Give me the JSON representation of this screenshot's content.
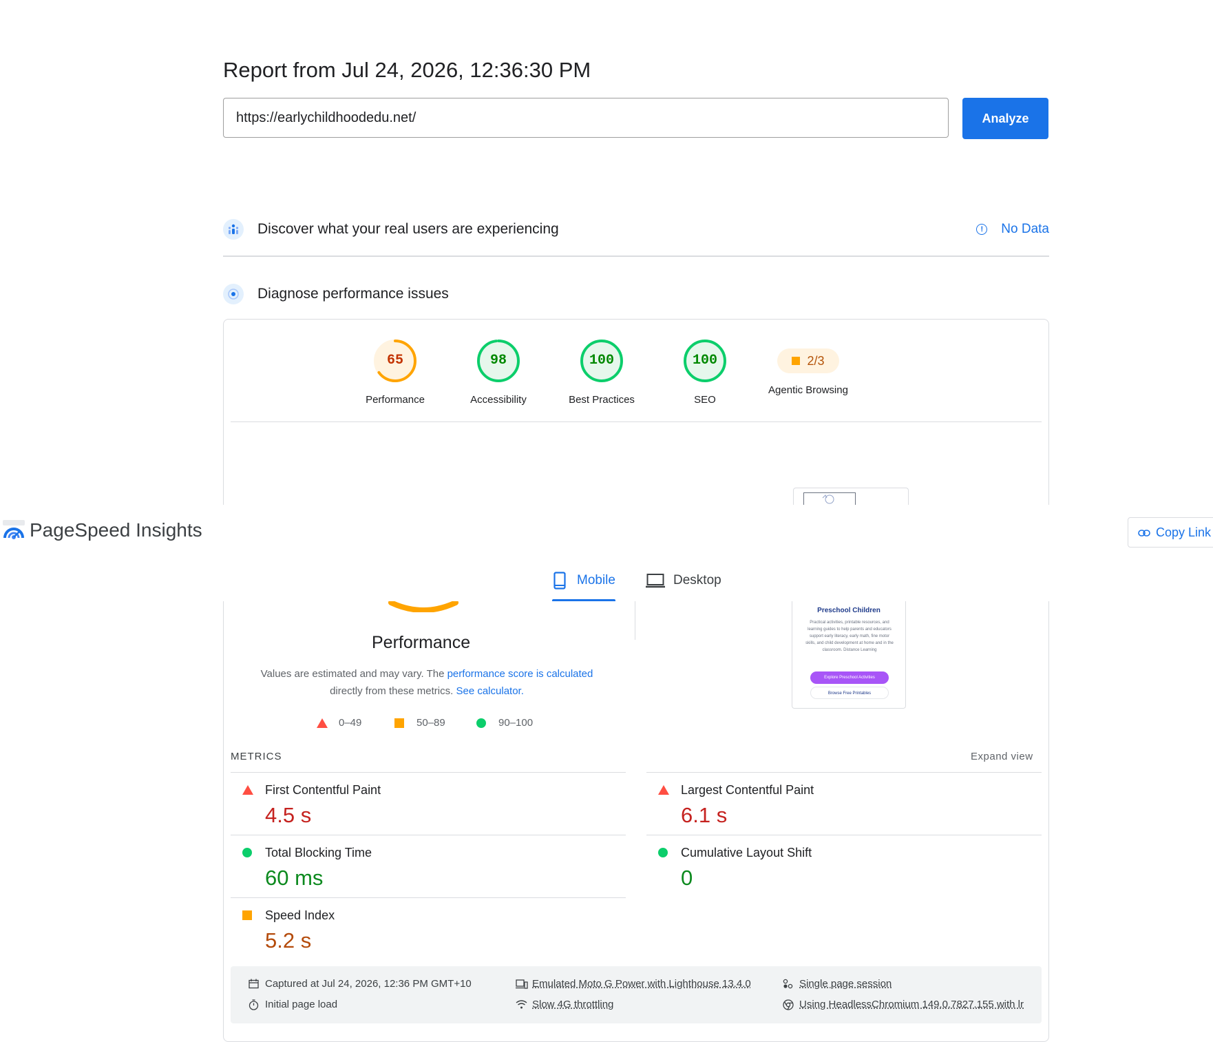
{
  "report": {
    "title": "Report from Jul 24, 2026, 12:36:30 PM",
    "url_value": "https://earlychildhoodedu.net/",
    "analyze_label": "Analyze"
  },
  "field_data": {
    "title": "Discover what your real users are experiencing",
    "status": "No Data"
  },
  "diagnose": {
    "title": "Diagnose performance issues"
  },
  "scores": [
    {
      "value": "65",
      "label": "Performance",
      "score": 65,
      "color": "#ffa400",
      "fill": "#fff3e0",
      "text": "#c33300"
    },
    {
      "value": "98",
      "label": "Accessibility",
      "score": 98,
      "color": "#0cce6b",
      "fill": "#e6f7ec",
      "text": "#008800"
    },
    {
      "value": "100",
      "label": "Best Practices",
      "score": 100,
      "color": "#0cce6b",
      "fill": "#e6f7ec",
      "text": "#008800"
    },
    {
      "value": "100",
      "label": "SEO",
      "score": 100,
      "color": "#0cce6b",
      "fill": "#e6f7ec",
      "text": "#008800"
    }
  ],
  "agentic": {
    "value": "2/3",
    "label": "Agentic Browsing"
  },
  "header": {
    "title": "PageSpeed Insights",
    "copy_link": "Copy Link"
  },
  "tabs": {
    "mobile": "Mobile",
    "desktop": "Desktop",
    "active": "mobile"
  },
  "performance": {
    "title": "Performance",
    "note_prefix": "Values are estimated and may vary. The ",
    "note_link1": "performance score is calculated",
    "note_middle": "directly from these metrics.",
    "note_link2": "See calculator.",
    "legend": [
      "0–49",
      "50–89",
      "90–100"
    ]
  },
  "screenshot": {
    "heading": "Preschool Children",
    "text": "Practical activities, printable resources, and learning guides to help parents and educators support early literacy, early math, fine motor skills, and child development at home and in the classroom. Distance Learning",
    "button1": "Explore Preschool Activities",
    "button2": "Browse Free Printables"
  },
  "metrics": {
    "label": "METRICS",
    "expand": "Expand view",
    "items": [
      {
        "name": "First Contentful Paint",
        "value": "4.5 s",
        "rating": "fail"
      },
      {
        "name": "Largest Contentful Paint",
        "value": "6.1 s",
        "rating": "fail"
      },
      {
        "name": "Total Blocking Time",
        "value": "60 ms",
        "rating": "pass"
      },
      {
        "name": "Cumulative Layout Shift",
        "value": "0",
        "rating": "pass"
      },
      {
        "name": "Speed Index",
        "value": "5.2 s",
        "rating": "average"
      }
    ]
  },
  "run_info": {
    "captured": "Captured at Jul 24, 2026, 12:36 PM GMT+10",
    "initial_load": "Initial page load",
    "device": "Emulated Moto G Power with Lighthouse 13.4.0",
    "throttling": "Slow 4G throttling",
    "session": "Single page session",
    "browser": "Using HeadlessChromium 149.0.7827.155 with lr"
  },
  "colors": {
    "accent": "#1a73e8",
    "fail": "#ff4e42",
    "average": "#ffa400",
    "pass": "#0cce6b"
  }
}
